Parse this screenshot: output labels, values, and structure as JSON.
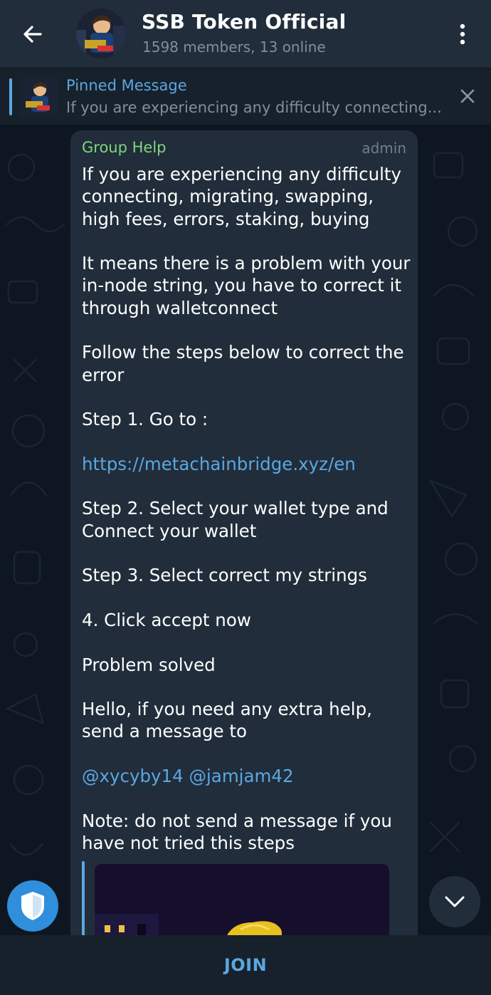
{
  "header": {
    "title": "SSB Token Official",
    "subtitle": "1598 members, 13 online",
    "back_icon": "arrow-left-icon",
    "menu_icon": "more-vertical-icon"
  },
  "pinned": {
    "title": "Pinned Message",
    "text": "If you are experiencing any difficulty connecting...",
    "close_icon": "close-icon"
  },
  "message": {
    "sender": "Group Help",
    "role": "admin",
    "paragraphs": [
      "If you are experiencing any difficulty connecting,  migrating,  swapping,  high fees, errors,  staking, buying",
      "It means there is a problem with your in-node string,  you have to correct it through walletconnect",
      "Follow the steps below to correct the error",
      "Step 1. Go to :",
      "Step 2. Select your wallet type and Connect your wallet",
      "Step 3. Select correct my strings",
      "4. Click accept now",
      "Problem solved",
      "Hello, if you need any extra help, send a message to",
      "Note: do not send a message if you have not tried this steps"
    ],
    "link_url": "https://metachainbridge.xyz/en",
    "mention_1": "@xycyby14",
    "mention_2": "@jamjam42"
  },
  "floating": {
    "shield_icon": "shield-icon",
    "scroll_down_icon": "chevron-down-icon"
  },
  "bottom": {
    "join_label": "JOIN"
  },
  "colors": {
    "header_bg": "#212d3b",
    "chat_bg": "#0e1621",
    "accent": "#5ba7e0",
    "sender": "#7fd67f"
  }
}
